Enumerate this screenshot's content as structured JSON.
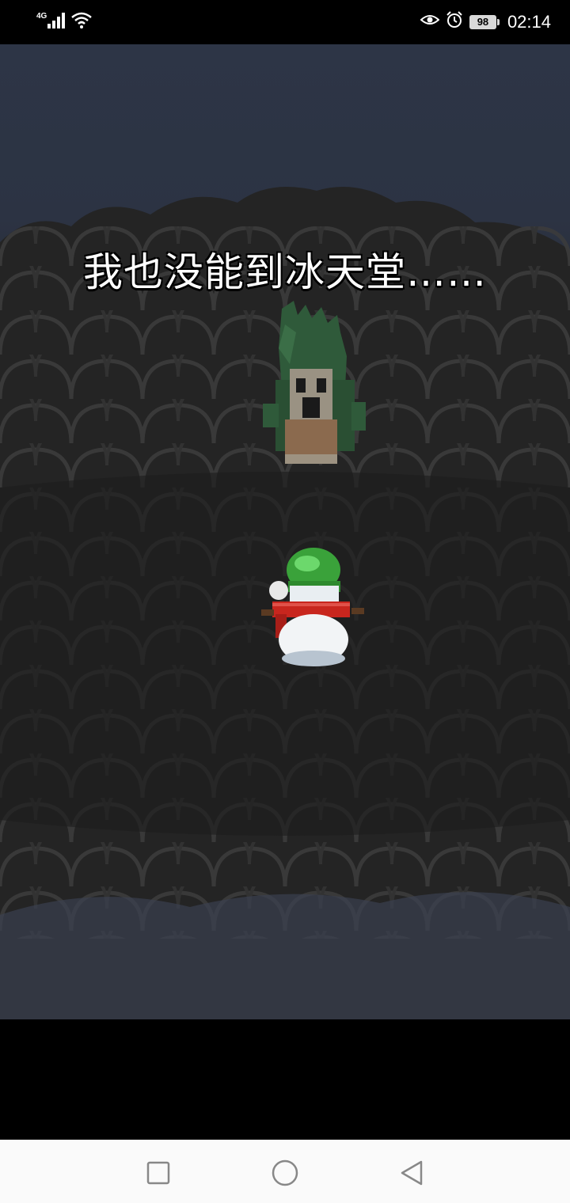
{
  "status_bar": {
    "network_type": "4G",
    "battery_level": "98",
    "time": "02:14",
    "icons": [
      "signal-icon",
      "wifi-icon",
      "eye-comfort-icon",
      "alarm-icon",
      "battery-icon"
    ]
  },
  "game": {
    "dialogue_text": "我也没能到冰天堂……",
    "characters": [
      "dragon-costume-character",
      "snowman-player"
    ],
    "colors": {
      "sky_top": "#2d3546",
      "cloud_dark": "#1e1e1e",
      "cloud_outline": "#3a3a3a",
      "dragon_green": "#2f5a3a",
      "hat_green": "#3aa23a",
      "scarf_red": "#c8261e",
      "snow_white": "#f2f4f6"
    }
  },
  "nav_bar": {
    "buttons": [
      "recent-apps-button",
      "home-button",
      "back-button"
    ]
  }
}
